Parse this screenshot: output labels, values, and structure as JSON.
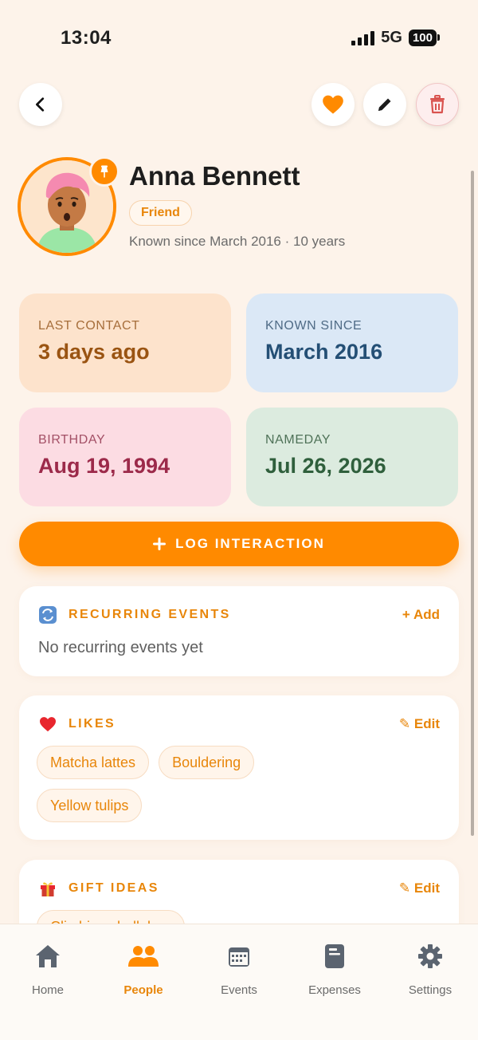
{
  "status_bar": {
    "time": "13:04",
    "network": "5G",
    "battery": "100"
  },
  "profile": {
    "name": "Anna Bennett",
    "tag": "Friend",
    "known_line": "Known since March 2016 · 10 years"
  },
  "tiles": [
    {
      "label": "LAST CONTACT",
      "value": "3 days ago"
    },
    {
      "label": "KNOWN SINCE",
      "value": "March 2016"
    },
    {
      "label": "BIRTHDAY",
      "value": "Aug 19, 1994"
    },
    {
      "label": "NAMEDAY",
      "value": "Jul 26, 2026"
    }
  ],
  "log_button": {
    "label": "LOG INTERACTION"
  },
  "sections": {
    "recurring": {
      "title": "RECURRING EVENTS",
      "action": "+ Add",
      "empty": "No recurring events yet"
    },
    "likes": {
      "title": "LIKES",
      "action": "✎ Edit",
      "items": [
        "Matcha lattes",
        "Bouldering",
        "Yellow tulips"
      ]
    },
    "gifts": {
      "title": "GIFT IDEAS",
      "action": "✎ Edit",
      "items": [
        "Climbing chalk bag"
      ]
    }
  },
  "nav": [
    {
      "label": "Home",
      "icon": "home-icon"
    },
    {
      "label": "People",
      "icon": "people-icon",
      "active": true
    },
    {
      "label": "Events",
      "icon": "calendar-icon"
    },
    {
      "label": "Expenses",
      "icon": "receipt-icon"
    },
    {
      "label": "Settings",
      "icon": "gear-icon"
    }
  ],
  "colors": {
    "accent": "#ff8a00",
    "background": "#fdf3ea",
    "danger": "#d9534f"
  }
}
